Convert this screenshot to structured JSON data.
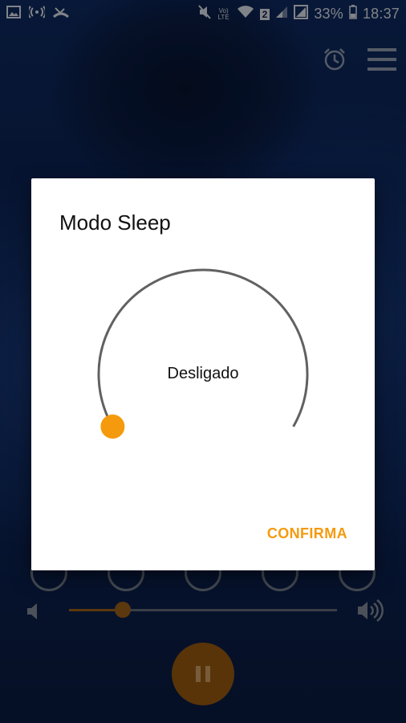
{
  "status_bar": {
    "battery_percent": "33%",
    "time": "18:37",
    "volte_label": "Vo) LTE",
    "sim_badge": "2"
  },
  "top_actions": {
    "alarm_icon": "alarm-clock-icon",
    "menu_icon": "hamburger-menu-icon"
  },
  "dialog": {
    "title": "Modo Sleep",
    "dial_value_label": "Desligado",
    "confirm_label": "CONFIRMA",
    "dial_progress": 0
  },
  "player": {
    "volume_level": 0.2,
    "play_state": "pause-icon"
  },
  "colors": {
    "accent": "#F59A0D",
    "dial_ring": "#616161",
    "dialog_bg": "#FFFFFF"
  }
}
